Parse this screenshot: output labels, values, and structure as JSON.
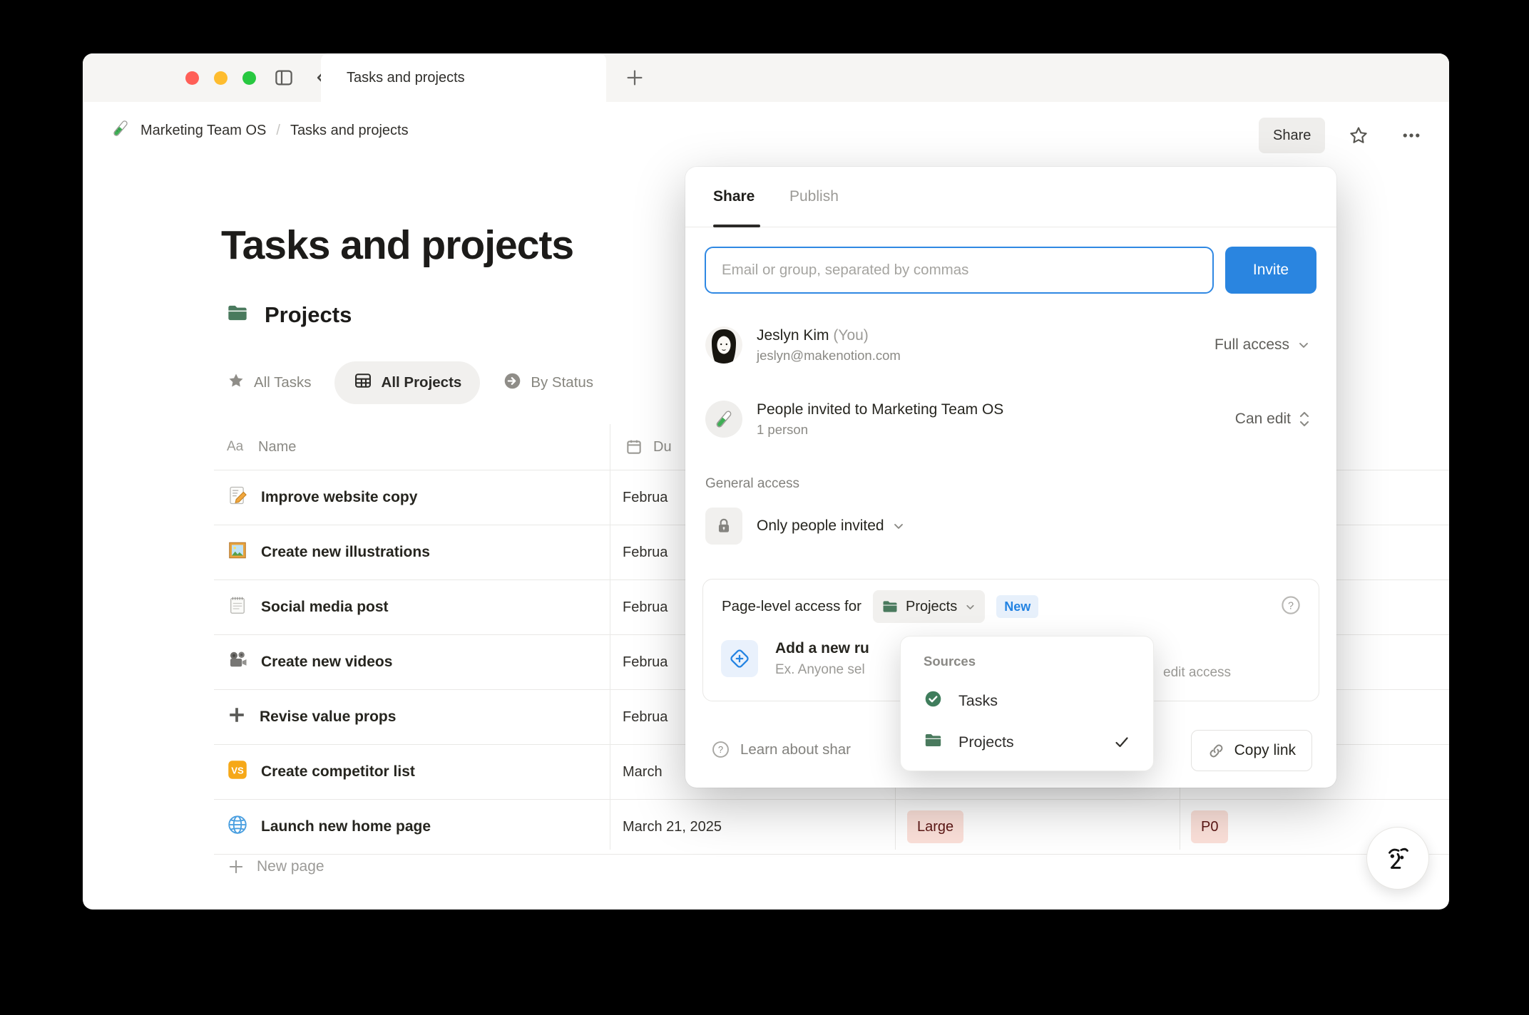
{
  "colors": {
    "accent_blue": "#2383e2",
    "folder_green": "#4a7a5e",
    "tag_bg": "#fbe0d9",
    "tag_text": "#5d1715",
    "titlebar_bg": "#f6f5f3"
  },
  "window": {
    "tab_title": "Tasks and projects",
    "new_tab_label": "+"
  },
  "breadcrumb": {
    "workspace": "Marketing Team OS",
    "separator": "/",
    "page": "Tasks and projects"
  },
  "topbar": {
    "share_label": "Share"
  },
  "page": {
    "title": "Tasks and projects",
    "section_title": "Projects"
  },
  "views": [
    {
      "label": "All Tasks",
      "icon": "star-icon"
    },
    {
      "label": "All Projects",
      "icon": "table-icon"
    },
    {
      "label": "By Status",
      "icon": "arrow-circle-icon"
    }
  ],
  "table": {
    "name_type_icon": "Aa",
    "name_header": "Name",
    "due_header": "Du",
    "rows": [
      {
        "icon": "memo",
        "name": "Improve website copy",
        "due": "Februa"
      },
      {
        "icon": "picture",
        "name": "Create new illustrations",
        "due": "Februa"
      },
      {
        "icon": "notepad",
        "name": "Social media post",
        "due": "Februa"
      },
      {
        "icon": "camera",
        "name": "Create new videos",
        "due": "Februa"
      },
      {
        "icon": "plus",
        "name": "Revise value props",
        "due": "Februa"
      },
      {
        "icon": "vs",
        "name": "Create competitor list",
        "due": "March"
      },
      {
        "icon": "globe",
        "name": "Launch new home page",
        "due": "March 21, 2025",
        "size": "Large",
        "priority": "P0"
      }
    ],
    "new_page_label": "New page"
  },
  "share_dialog": {
    "tab_share": "Share",
    "tab_publish": "Publish",
    "invite_input_placeholder": "Email or group, separated by commas",
    "invite_button": "Invite",
    "person1": {
      "name": "Jeslyn Kim",
      "you_suffix": "(You)",
      "email": "jeslyn@makenotion.com",
      "access": "Full access"
    },
    "person2": {
      "name": "People invited to Marketing Team OS",
      "subtitle": "1 person",
      "access": "Can edit"
    },
    "general_access_label": "General access",
    "general_access_value": "Only people invited",
    "page_level_card": {
      "prefix": "Page-level access for",
      "selector": "Projects",
      "badge": "New",
      "rule_title": "Add a new ru",
      "rule_subtitle": "Ex. Anyone sel",
      "rule_subtitle_tail": "edit access"
    },
    "footer": {
      "learn_link": "Learn about shar",
      "copy_link": "Copy link"
    }
  },
  "sources_menu": {
    "title": "Sources",
    "items": [
      {
        "label": "Tasks",
        "icon": "check-circle-icon",
        "checked": false
      },
      {
        "label": "Projects",
        "icon": "folder-icon",
        "checked": true
      }
    ]
  }
}
